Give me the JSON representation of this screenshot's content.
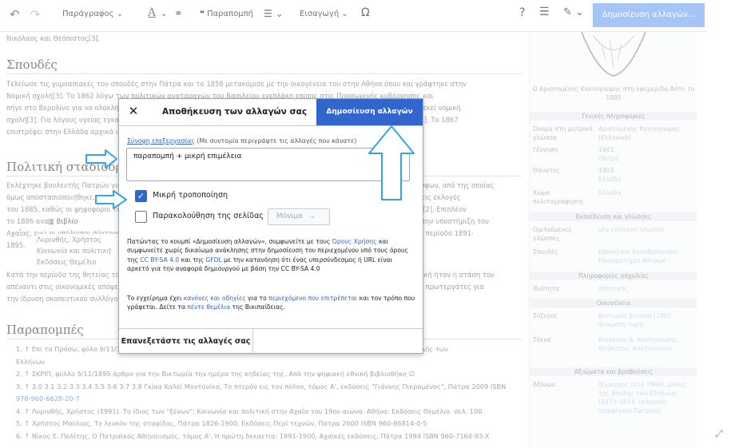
{
  "toolbar": {
    "paragraph_label": "Παράγραφος",
    "citation_label": "Παραπομπή",
    "insert_label": "Εισαγωγή",
    "special_char": "Ω",
    "help": "?",
    "publish_label": "Δημοσίευση αλλαγών..."
  },
  "article": {
    "intro_line": "Νικόλαος και Θεόπιστος[3].",
    "sec_studies": "Σπουδές",
    "studies_text_1": "Τελείωσε τις γυμνασιακές του σπουδές στην Πάτρα και το 1858 μετακόμισε με την οικογένεια του στην Αθήνα όπου και γράφτηκε στην",
    "studies_text_2": "Νομική σχολή[3]. Το 1862 λόγω των πολιτικών αναταραχών του Βασιλείου ενεπλάκη επίσης στις Προσωρινής κυβέρνησης και",
    "studies_text_3": "πήγε στο Βερολίνο για να ολοκληρώσει τις σπουδές του με σκοπό να εισαχθεί στην υπηρεσία. Δεν σπούδασε ατύχημα στην εκεί νομική",
    "studies_text_4": "σχολή[3]. Για λόγους υγείας εγκατέλειψε τις σπουδές του και επέστρεψε στο Βερολίνο να ολοκληρώσει στη νομική σχολή[3]. Το 1867",
    "studies_text_5": "επιστρέφει στην Ελλάδα αρχικά ως δικηγόρος στην Πάτρα και μετά ως ένας από τους ιδρυτές του ιδιωτικού γραφείου[3].",
    "sec_politics": "Πολιτική σταδιοδρομία",
    "pol_1": "Εκλέχτηκε βουλευτής Πατρών για πρώτη φορά το 1872 και επανεξελέγη το 1875, το 1879, και το 1881 ως κομματικός Ρούφων, από της οποίας",
    "pol_2": "όμως αποστασιοποιήθηκε, και εξελέγη αργότερα δημοτικός σύμβουλος. Παρόλα αυτά αποτέλεσε βουλευτής και απέτυχε στις εκλογές",
    "pol_3": "του 1885, καθώς οι ψηφοφόροι τον κατηγόρησαν ότι ήταν υπέρ των Τρικουπικών. Ανεξάρτητος πλέον βουλευτής του 1885[2]. Επιπλέον",
    "pol_4": "το 1886 αναδείχθηκε σε ηγέτη του ανεξάρτητου κόμματος και παρέμεινε στο αξίωμα αυτό μέχρι του θανάτου του και για την υποστήριξη του",
    "pol_5": "Αχαΐας, ενώ οι υπόλοιποι σύντροφοί του αναδείχθηκαν συνεργάτες με τα αποτελέσματα των εκλογών του 1890 και για την περίοδο 1891-",
    "pol_6": "1895.",
    "book_label": "Βιβλίο",
    "book_1": "Λυρινθής, Χρήστος",
    "book_2": "Κοινωνία και πολιτική",
    "book_3": "Εκδόσεις Θεμέλιο",
    "pol_7": "Κατά την περίοδο της θητείας του το 1892 συμμετείχε στον εορτασμό του έτους ο σύλλογος. Η πολιτική και δημοσιογραφική ήταν η στάση του",
    "pol_8": "απέναντι στις οικονομικές απόψεις της εποχής που υπερασπιζόταν ο ίδιος στον τόπο και στο οποίο ήταν ανάμεσα στο τους πρωτεργάτες για",
    "pol_9": "την ίδρυση σκοπευτικού συλλόγου στην Πάτρα και μετά μεγαλύτερος του σπουδαστικού συλλόγου της Αχαΐας[3].",
    "sec_refs": "Παραπομπές",
    "refs": [
      "1. ↑ Επί τα Πρόσω, φύλο 9/11/1895 - Αρχεία της Βουλής των Ελλήνων ......................................................... αρχείο της Βουλής των",
      "    Ελλήνων",
      "2. ↑ ΣΚΡΙΠ, φύλλο 5/11/1895 άρθρο για την Βικτωρία την ημέρα της κηδείας της. Από την ψηφιακή εθνική βιβλιοθήκη ☑",
      "3. ↑ 3.0 3.1 3.2 3.3 3.4 3.5 3.6 3.7 3.8 Γκίκα Καλεί Μοντονίκα, Το πτερόν εις τον πύλον, τόμος Α', εκδόσεις \"Γιάννης Πικραμένος\", Πάτρα 2009 ISBN",
      "    978-960-6628-20-7",
      "4. ↑ Λυρινθής, Χρήστος (1991). Το ίδιος των \"ξένων\": Κοινωνία και πολιτική στην Αχαΐα του 19ου αιώνα. Αθήνα: Εκδόσεις Θεμέλιο. σελ. 100",
      "5. ↑ Χρήστος Μούλιος, Το λευκόν της σταφίδος, Πάτρα 1826-1900, Εκδόσεις Περί τεχνών, Πάτρα 2000 ISBN 960-86814-0-5",
      "6. ↑ Νίκος Ε. Πολίτης, Ο Πατραϊκός Αθηναιισμός, τόμος Α', Η πρώτη δεκαετία: 1891-1900, Αχαϊκές εκδόσεις, Πάτρα 1994 ISBN 960-7164-93-X"
    ]
  },
  "infobox": {
    "caption": "Ο Αριστομένης Κοντογούρης στη εφημερίδα Άστυ το 1885",
    "general": "Γενικές πληροφορίες",
    "rows1": [
      {
        "k": "Όνομα στη μητρική γλώσσα",
        "v": "Αριστομένης Κοντογούρης (Ελληνικά)"
      },
      {
        "k": "Γέννηση",
        "v": "1841"
      },
      {
        "k": "",
        "v": "Πάτρα"
      },
      {
        "k": "Θάνατος",
        "v": "1903"
      },
      {
        "k": "",
        "v": "Ελλάδα"
      },
      {
        "k": "Χώρα πολιτογράφησης",
        "v": "Ελλάδα"
      }
    ],
    "education": "Εκπαίδευση και γλώσσες",
    "rows2": [
      {
        "k": "Ομιλούμενες γλώσσες",
        "v": "νέα ελληνική γλώσσα"
      },
      {
        "k": "Σπουδές",
        "v": "Εθνικό και Καποδιστριακό Πανεπιστήμιο Αθηνών"
      }
    ],
    "occupation": "Πληροφορίες ασχολίας",
    "rows3": [
      {
        "k": "Ιδιότητα",
        "v": "πολιτικός"
      }
    ],
    "family": "Οικογένεια",
    "rows4": [
      {
        "k": "Σύζυγος",
        "v": "Βικτωρία Σιτιανή (1865–άγνωστη τιμή)"
      },
      {
        "k": "Τέκνα",
        "v": "Νικόλαος Α. Κοντογούρης, Θεόπιστος Κοντογούρης"
      }
    ],
    "offices": "Αξιώματα και βραβεύσεις",
    "rows5": [
      {
        "k": "Αξίωμα",
        "v": "δήμαρχος (από 1890), μέλος της Βουλής των Ελλήνων (1873–1874, εκλογική περιφέρεια Πατρών)"
      }
    ]
  },
  "dialog": {
    "close": "✕",
    "title": "Αποθήκευση των αλλαγών σας",
    "publish": "Δημοσίευση αλλαγών",
    "summary_link": "Σύνοψη επεξεργασίας",
    "summary_hint": " (Με συντομία περιγράψτε τις αλλαγές που κάνατε)",
    "summary_value": "παραπομπή + μικρή επιμέλεια",
    "minor_label": "Μικρή τροποποίηση",
    "watch_label": "Παρακολούθηση της σελίδας",
    "watch_select": "Μόνιμα",
    "legal_1": "Πατώντας το κουμπί «Δημοσίευση αλλαγών», συμφωνείτε με τους ",
    "legal_terms": "Όρους Χρήσης",
    "legal_2": " και συμφωνείτε χωρίς δικαίωμα ανάκλησης στην δημοσίευση του περιεχομένου υπό τους όρους της ",
    "legal_cc": "CC BY-SA 4.0",
    "legal_3": " και της ",
    "legal_gfdl": "GFDL",
    "legal_4": " με την κατανόηση ότι ένας υπερσύνδεσμος ή URL είναι αρκετό για την αναφορά δημιουργού με βάση την CC BY-SA 4.0",
    "rules_1": "Το εγχείρημα έχει ",
    "rules_link1": "κανόνες και οδηγίες",
    "rules_2": " για το ",
    "rules_link2": "περιεχόμενο που επιτρέπεται",
    "rules_3": " και τον τρόπο που γράφεται. Δείτε τα ",
    "rules_link3": "πέντε θεμέλια",
    "rules_4": " της Βικιπαίδειας.",
    "review": "Επανεξετάστε τις αλλαγές σας"
  },
  "colors": {
    "accent": "#3366cc",
    "arrow": "#36a3e6"
  }
}
